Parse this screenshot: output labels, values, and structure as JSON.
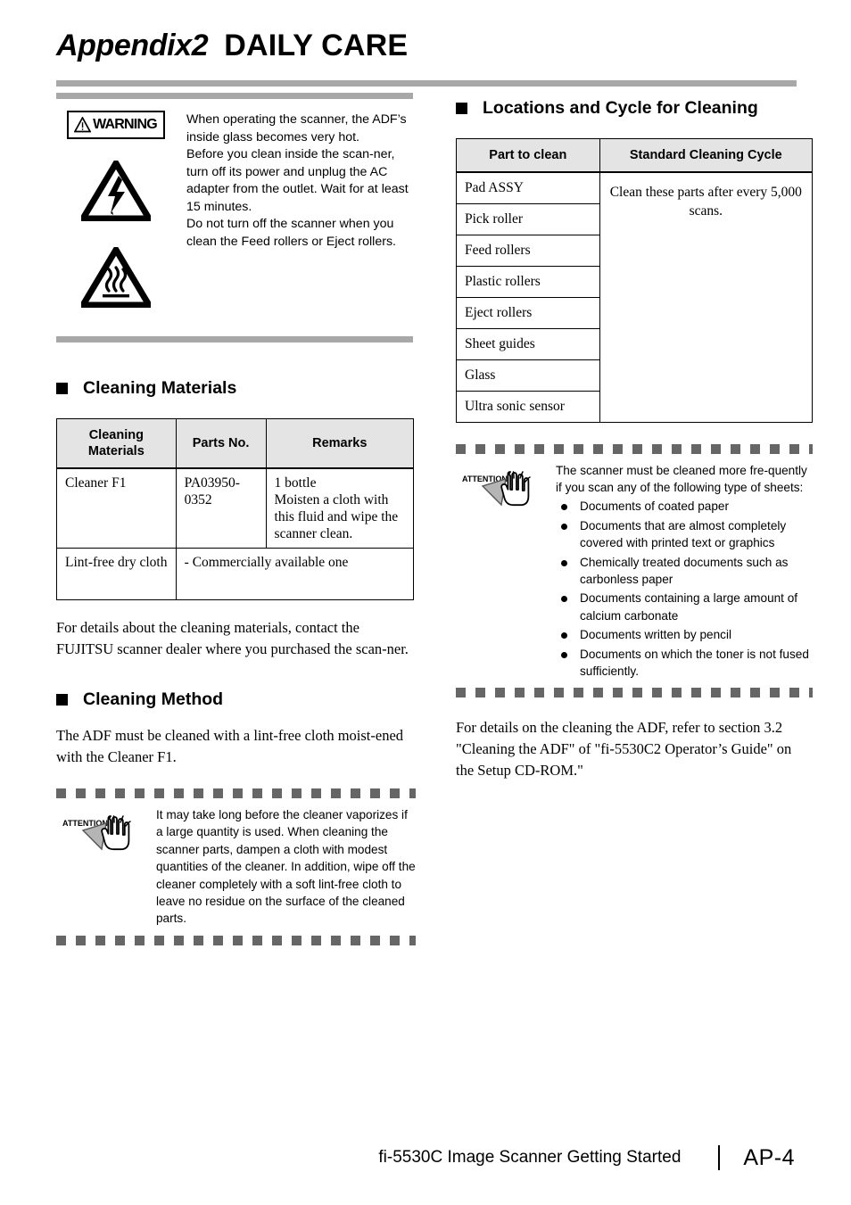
{
  "header": {
    "appendix_label": "Appendix2",
    "title": "DAILY CARE"
  },
  "warning": {
    "label": "WARNING",
    "icons": [
      "warning-triangle-icon",
      "electric-shock-icon",
      "hot-surface-icon"
    ],
    "paragraphs": [
      "When operating the scanner, the ADF’s inside glass becomes very hot.",
      "Before you clean inside the scan-ner, turn off its power and unplug the AC adapter from the outlet. Wait for at least 15 minutes.",
      "Do not turn off the scanner when you clean the Feed rollers or Eject rollers."
    ]
  },
  "cleaning_materials": {
    "heading": "Cleaning Materials",
    "table": {
      "columns": [
        "Cleaning\nMaterials",
        "Parts No.",
        "Remarks"
      ],
      "rows": [
        {
          "material": "Cleaner F1",
          "parts_no": "PA03950-0352",
          "remarks": "1 bottle\nMoisten a cloth with this fluid and wipe the scanner clean."
        },
        {
          "material": "Lint-free dry cloth",
          "remarks_full": "- Commercially available one"
        }
      ]
    },
    "note": "For details about the cleaning materials, contact the FUJITSU scanner dealer where you purchased the scan-ner."
  },
  "cleaning_method": {
    "heading": "Cleaning Method",
    "intro": "The ADF must be cleaned with a lint-free cloth moist-ened with the Cleaner F1.",
    "attention": {
      "label": "ATTENTION",
      "icon": "attention-hand-icon",
      "text": "It may take long before the cleaner vaporizes if a large quantity is used. When cleaning the scanner parts, dampen a cloth with modest quantities of the cleaner. In addition, wipe off the cleaner completely with a soft lint-free cloth to leave no residue on the surface of the cleaned parts."
    }
  },
  "locations_cycle": {
    "heading": "Locations and Cycle for Cleaning",
    "table": {
      "columns": [
        "Part to clean",
        "Standard Cleaning Cycle"
      ],
      "parts": [
        "Pad ASSY",
        "Pick roller",
        "Feed rollers",
        "Plastic rollers",
        "Eject rollers",
        "Sheet guides",
        "Glass",
        "Ultra sonic sensor"
      ],
      "cycle": "Clean these parts after every 5,000 scans."
    },
    "attention": {
      "label": "ATTENTION",
      "icon": "attention-hand-icon",
      "intro": "The scanner must be cleaned more fre-quently if you scan any of the following type of sheets:",
      "items": [
        "Documents of coated paper",
        "Documents that are almost completely covered with printed text or graphics",
        "Chemically treated documents such as carbonless paper",
        "Documents containing a large amount of calcium carbonate",
        "Documents written by pencil",
        "Documents on which the toner is not fused sufficiently."
      ]
    },
    "reference": "For details on the cleaning the ADF, refer to section 3.2 \"Cleaning the ADF\" of \"fi-5530C2 Operator’s Guide\" on the Setup CD-ROM.\""
  },
  "footer": {
    "doc_title": "fi-5530C Image Scanner Getting Started",
    "page_number": "AP-4"
  },
  "colors": {
    "rule_gray": "#a8a8a8",
    "table_header_gray": "#e4e4e4",
    "dash_gray": "#666666"
  }
}
